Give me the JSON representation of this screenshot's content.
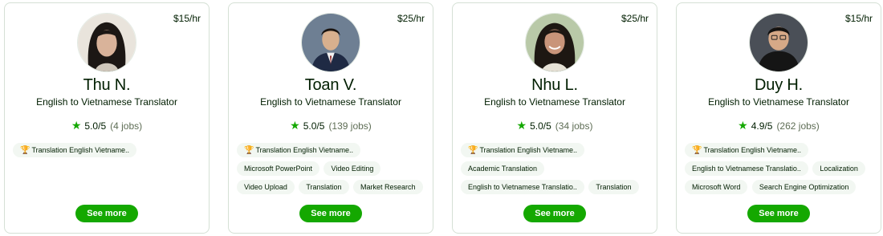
{
  "colors": {
    "accent": "#14a800",
    "border": "#d5e0d5",
    "chip": "#f2f7f2",
    "muted": "#5e6d55"
  },
  "cards": [
    {
      "rate": "$15/hr",
      "name": "Thu N.",
      "title": "English to Vietnamese Translator",
      "rating": "5.0/5",
      "jobs": "(4 jobs)",
      "top_skill": "Translation English Vietname..",
      "skills": [],
      "button": "See more"
    },
    {
      "rate": "$25/hr",
      "name": "Toan V.",
      "title": "English to Vietnamese Translator",
      "rating": "5.0/5",
      "jobs": "(139 jobs)",
      "top_skill": "Translation English Vietname..",
      "skills": [
        "Microsoft PowerPoint",
        "Video Editing",
        "Video Upload",
        "Translation",
        "Market Research"
      ],
      "button": "See more"
    },
    {
      "rate": "$25/hr",
      "name": "Nhu L.",
      "title": "English to Vietnamese Translator",
      "rating": "5.0/5",
      "jobs": "(34 jobs)",
      "top_skill": "Translation English Vietname..",
      "skills": [
        "Academic Translation",
        "English to Vietnamese Translatio..",
        "Translation"
      ],
      "button": "See more"
    },
    {
      "rate": "$15/hr",
      "name": "Duy H.",
      "title": "English to Vietnamese Translator",
      "rating": "4.9/5",
      "jobs": "(262 jobs)",
      "top_skill": "Translation English Vietname..",
      "skills": [
        "English to Vietnamese Translatio..",
        "Localization",
        "Microsoft Word",
        "Search Engine Optimization"
      ],
      "button": "See more"
    }
  ]
}
